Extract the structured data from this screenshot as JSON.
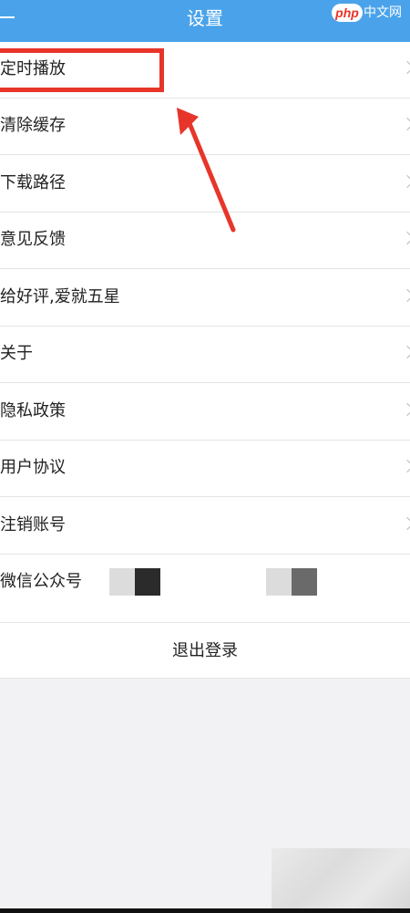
{
  "header": {
    "title": "设置",
    "watermark": {
      "php": "php",
      "cn": "中文网"
    }
  },
  "settings_items": [
    {
      "label": "定时播放"
    },
    {
      "label": "清除缓存"
    },
    {
      "label": "下载路径"
    },
    {
      "label": "意见反馈"
    },
    {
      "label": "给好评,爱就五星"
    },
    {
      "label": "关于"
    },
    {
      "label": "隐私政策"
    },
    {
      "label": "用户协议"
    },
    {
      "label": "注销账号"
    },
    {
      "label": "微信公众号"
    }
  ],
  "logout": {
    "label": "退出登录"
  },
  "colors": {
    "header_bg": "#4aa3ea",
    "annotation_red": "#e8352a"
  },
  "icons": {
    "row_chevron": "chevron-right-icon",
    "back": "back-line-icon"
  }
}
